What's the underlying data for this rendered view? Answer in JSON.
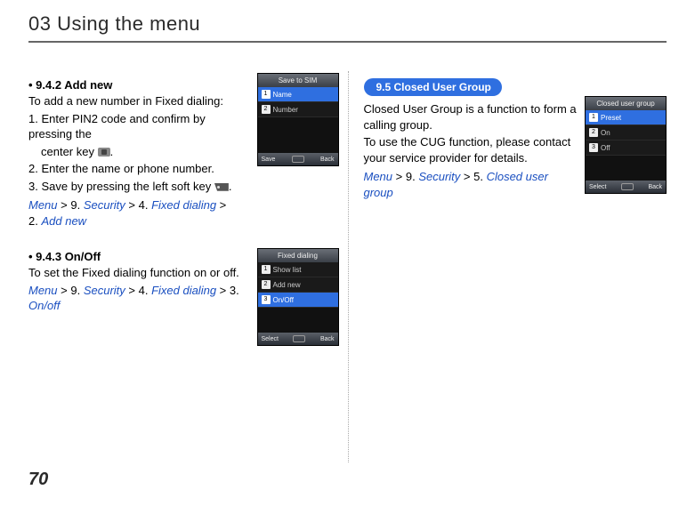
{
  "page": {
    "title": "03 Using the menu",
    "number": "70"
  },
  "left": {
    "s1": {
      "heading": "9.4.2  Add new",
      "intro": "To add a new number in Fixed dialing:",
      "step1a": "1. Enter PIN2 code and confirm by pressing the",
      "step1b": "center key",
      "step1c": ".",
      "step2": "2. Enter the name or phone number.",
      "step3a": "3. Save by pressing the left soft key",
      "step3b": ".",
      "nav_menu": "Menu",
      "nav_9": " > 9. ",
      "nav_security": "Security",
      "nav_4": " > 4. ",
      "nav_fixed": "Fixed dialing",
      "nav_gt": " >",
      "nav_2": "2. ",
      "nav_addnew": "Add new"
    },
    "s2": {
      "heading": "9.4.3  On/Off",
      "intro": "To set the Fixed dialing function on or off.",
      "nav_menu": "Menu",
      "nav_9": " > 9. ",
      "nav_security": "Security",
      "nav_4": " > 4. ",
      "nav_fixed": "Fixed dialing",
      "nav_3": " > 3. ",
      "nav_onoff": "On/off"
    },
    "phone1": {
      "title": "Save to SIM",
      "r1_num": "1",
      "r1_label": "Name",
      "r2_num": "2",
      "r2_label": "Number",
      "soft_left": "Save",
      "soft_right": "Back"
    },
    "phone2": {
      "title": "Fixed dialing",
      "r1_num": "1",
      "r1_label": "Show list",
      "r2_num": "2",
      "r2_label": "Add new",
      "r3_num": "3",
      "r3_label": "On/Off",
      "soft_left": "Select",
      "soft_right": "Back"
    }
  },
  "right": {
    "chip": "9.5  Closed User Group",
    "p1": "Closed User Group is a function to form a calling group.",
    "p2": "To use the CUG function, please contact your service provider for details.",
    "nav_menu": "Menu",
    "nav_9": " > 9. ",
    "nav_security": "Security",
    "nav_5": " > 5. ",
    "nav_cug": "Closed user group",
    "phone": {
      "title": "Closed user group",
      "r1_num": "1",
      "r1_label": "Preset",
      "r2_num": "2",
      "r2_label": "On",
      "r3_num": "3",
      "r3_label": "Off",
      "soft_left": "Select",
      "soft_right": "Back"
    }
  }
}
